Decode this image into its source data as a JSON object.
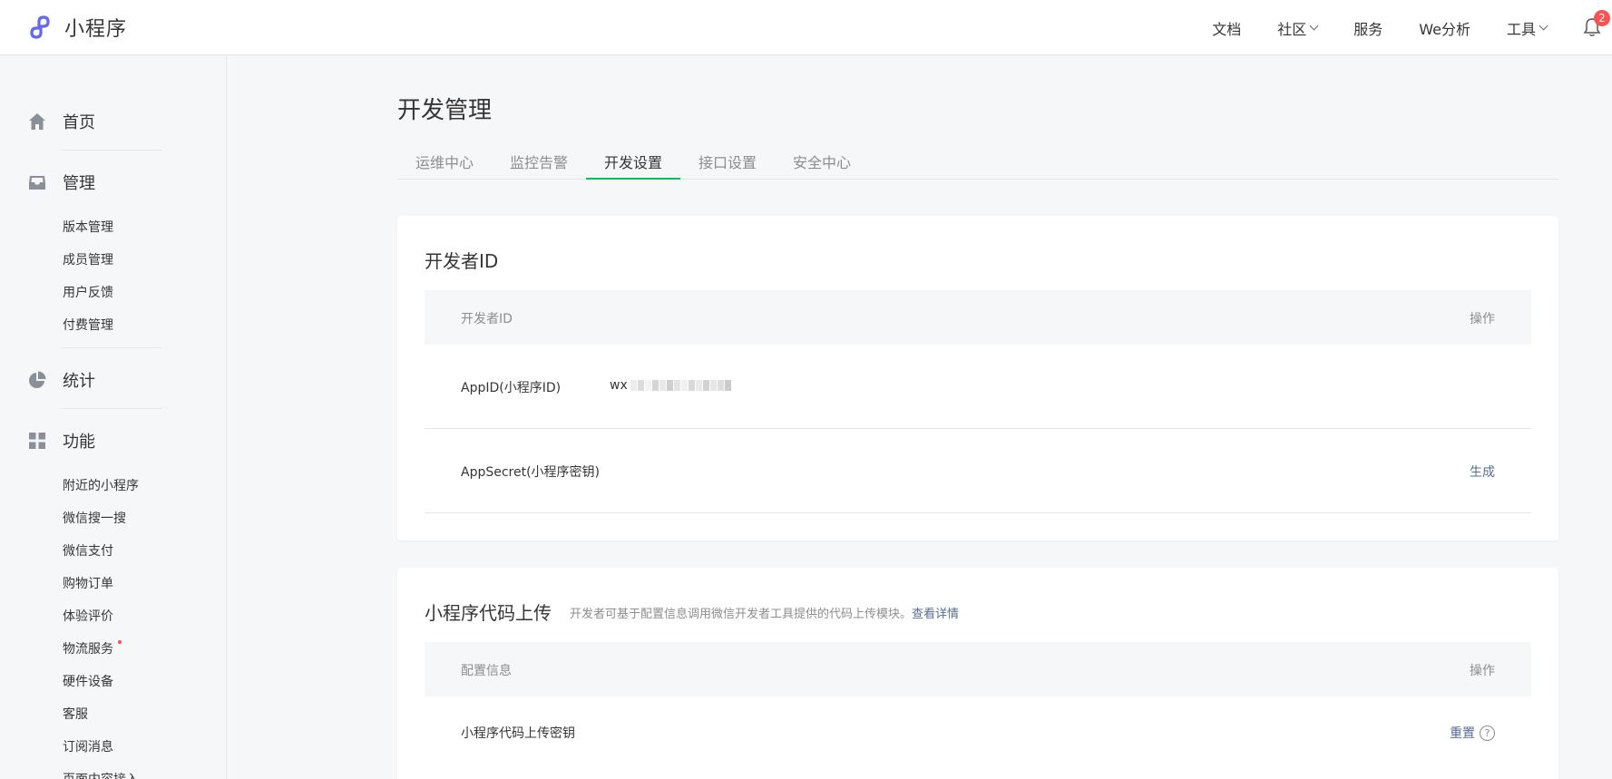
{
  "brand": {
    "name": "小程序",
    "logo_icon": "miniprogram-logo-icon",
    "color": "#6467f0"
  },
  "topnav": {
    "items": [
      {
        "label": "文档",
        "dropdown": false
      },
      {
        "label": "社区",
        "dropdown": true
      },
      {
        "label": "服务",
        "dropdown": false
      },
      {
        "label": "We分析",
        "dropdown": false
      },
      {
        "label": "工具",
        "dropdown": true
      }
    ],
    "notification_icon": "bell-icon",
    "notification_count": "2"
  },
  "sidebar": {
    "home": {
      "label": "首页",
      "icon": "home-icon"
    },
    "manage": {
      "label": "管理",
      "icon": "inbox-icon",
      "items": [
        "版本管理",
        "成员管理",
        "用户反馈",
        "付费管理"
      ]
    },
    "stats": {
      "label": "统计",
      "icon": "pie-chart-icon"
    },
    "features": {
      "label": "功能",
      "icon": "grid-icon",
      "items": [
        "附近的小程序",
        "微信搜一搜",
        "微信支付",
        "购物订单",
        "体验评价",
        "物流服务",
        "硬件设备",
        "客服",
        "订阅消息",
        "页面内容接入"
      ]
    }
  },
  "page": {
    "title": "开发管理",
    "tabs": [
      "运维中心",
      "监控告警",
      "开发设置",
      "接口设置",
      "安全中心"
    ],
    "active_tab": "开发设置",
    "accent_color": "#07c160"
  },
  "developer_id": {
    "title": "开发者ID",
    "header_left": "开发者ID",
    "header_right": "操作",
    "rows": [
      {
        "label": "AppID(小程序ID)",
        "value_prefix": "wx",
        "action": ""
      },
      {
        "label": "AppSecret(小程序密钥)",
        "value_prefix": "",
        "action": "生成"
      }
    ]
  },
  "code_upload": {
    "title": "小程序代码上传",
    "desc": "开发者可基于配置信息调用微信开发者工具提供的代码上传模块。",
    "desc_link": "查看详情",
    "header_left": "配置信息",
    "header_right": "操作",
    "rows": [
      {
        "label": "小程序代码上传密钥",
        "action": "重置",
        "help": "?"
      }
    ]
  }
}
